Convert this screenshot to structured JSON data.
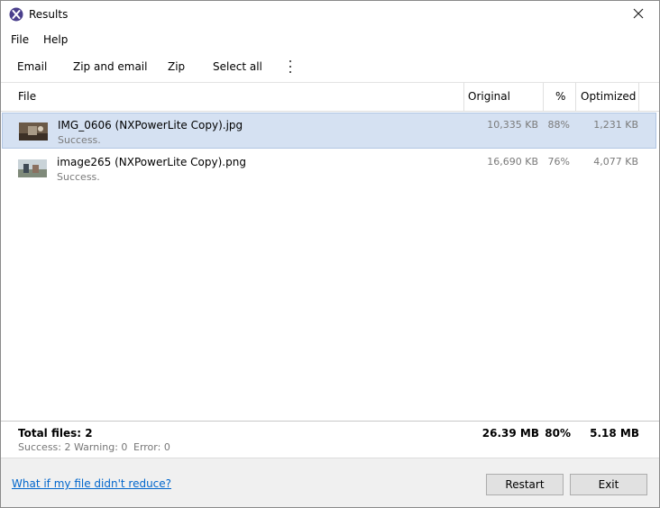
{
  "window": {
    "title": "Results"
  },
  "menu": {
    "file": "File",
    "help": "Help"
  },
  "toolbar": {
    "email": "Email",
    "zip_and_email": "Zip and email",
    "zip": "Zip",
    "select_all": "Select all",
    "more_icon": "more-vertical-icon"
  },
  "columns": {
    "file": "File",
    "original": "Original",
    "percent": "%",
    "optimized": "Optimized"
  },
  "rows": [
    {
      "name": "IMG_0606 (NXPowerLite Copy).jpg",
      "status": "Success.",
      "original": "10,335 KB",
      "percent": "88%",
      "optimized": "1,231 KB",
      "selected": true
    },
    {
      "name": "image265 (NXPowerLite Copy).png",
      "status": "Success.",
      "original": "16,690 KB",
      "percent": "76%",
      "optimized": "4,077 KB",
      "selected": false
    }
  ],
  "summary": {
    "total_files": "Total files: 2",
    "success": "Success: 2",
    "warning": "Warning: 0",
    "error": "Error: 0",
    "original_total": "26.39 MB",
    "percent_total": "80%",
    "optimized_total": "5.18 MB"
  },
  "bottom": {
    "help_link": "What if my file didn't reduce?",
    "restart": "Restart",
    "exit": "Exit"
  },
  "colors": {
    "selection": "#d5e1f2",
    "link": "#0066cc",
    "button_face": "#e1e1e1"
  }
}
